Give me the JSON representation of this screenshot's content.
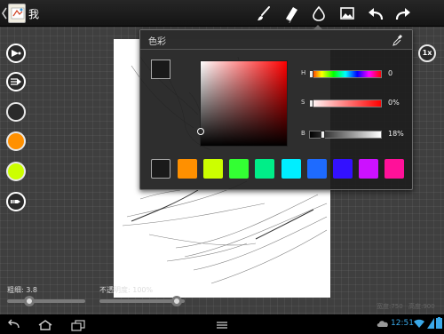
{
  "app": {
    "title": "我"
  },
  "toolbar": {
    "icons": [
      "brush-icon",
      "eraser-icon",
      "drop-icon",
      "image-icon",
      "undo-icon",
      "redo-icon"
    ]
  },
  "left_tools": {
    "swatches": [
      "#2a2a2a",
      "#ff9000",
      "#ccff00"
    ]
  },
  "zoom": {
    "label": "1x"
  },
  "color_picker": {
    "title": "色彩",
    "current_color": "#1a1a1a",
    "hue": {
      "label": "H",
      "value": "0",
      "fraction": 0.0
    },
    "saturation": {
      "label": "S",
      "value": "0%",
      "fraction": 0.0
    },
    "brightness": {
      "label": "B",
      "value": "18%",
      "fraction": 0.18
    },
    "palette": [
      "#1a1a1a",
      "#ff9000",
      "#ccff00",
      "#33ff33",
      "#00ee88",
      "#00eeff",
      "#1e6bff",
      "#3311ff",
      "#cc11ff",
      "#ff1199"
    ]
  },
  "bottom": {
    "thickness_label": "粗细: 3.8",
    "opacity_label": "不透明度: 100%",
    "opacity_fraction": 1.0,
    "width_readout": "宽度:750",
    "height_readout": "高度:900"
  },
  "status": {
    "time": "12:51"
  }
}
